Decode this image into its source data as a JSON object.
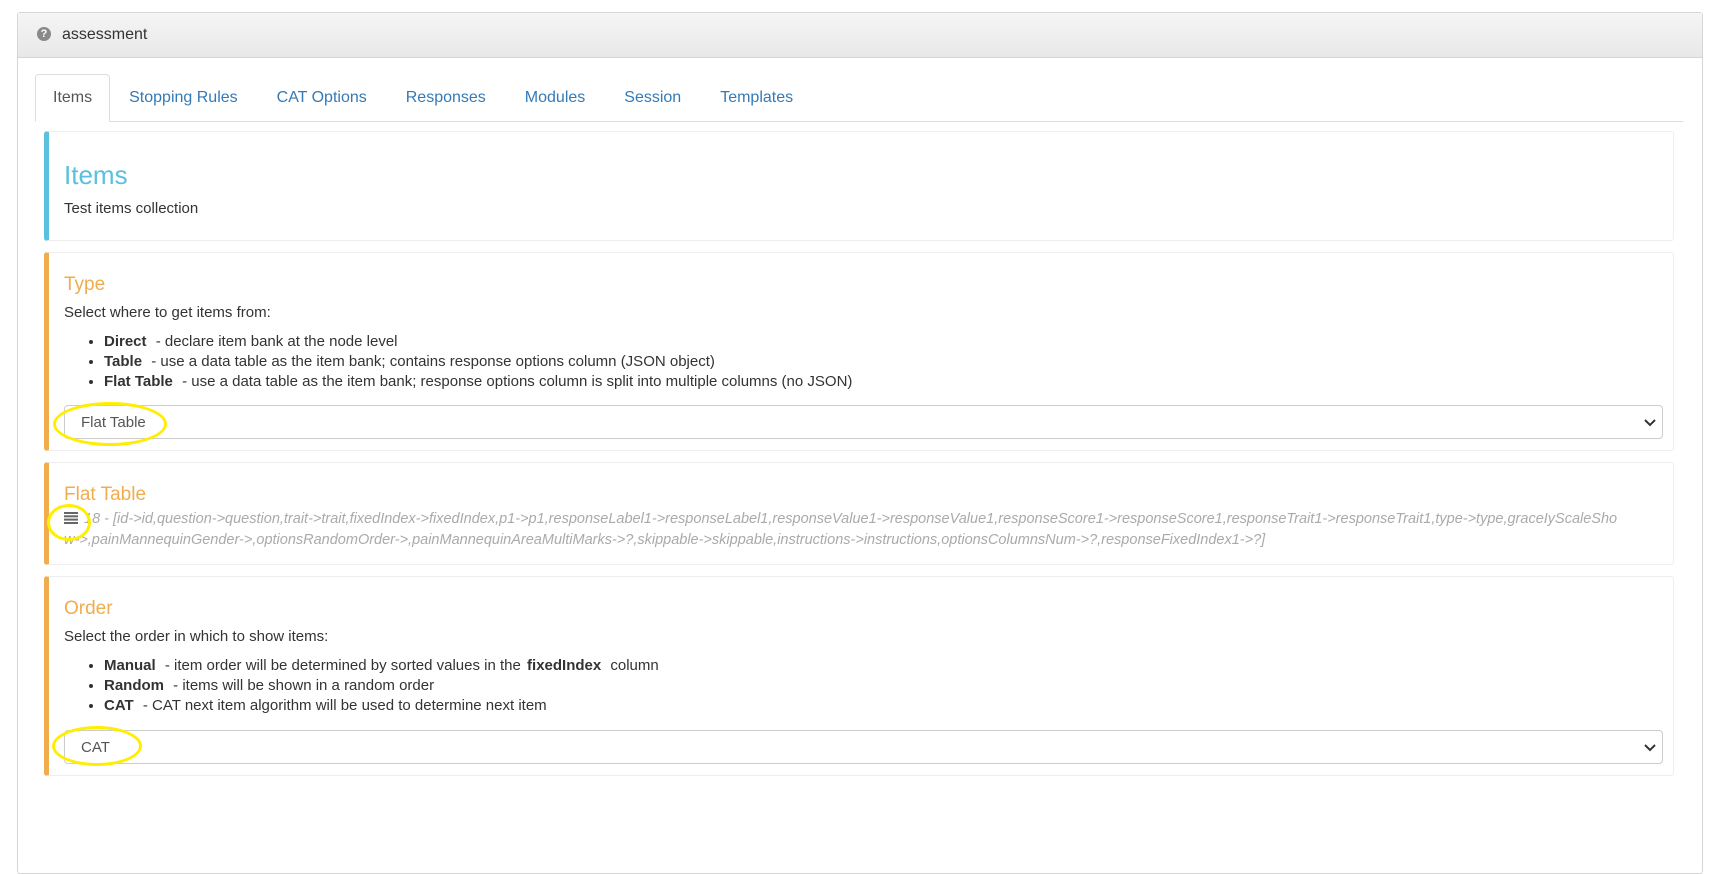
{
  "panel": {
    "title": "assessment"
  },
  "tabs": [
    {
      "label": "Items"
    },
    {
      "label": "Stopping Rules"
    },
    {
      "label": "CAT Options"
    },
    {
      "label": "Responses"
    },
    {
      "label": "Modules"
    },
    {
      "label": "Session"
    },
    {
      "label": "Templates"
    }
  ],
  "items_card": {
    "title": "Items",
    "description": "Test items collection"
  },
  "type_card": {
    "title": "Type",
    "description": "Select where to get items from:",
    "options": [
      {
        "name": "Direct",
        "text": " - declare item bank at the node level"
      },
      {
        "name": "Table",
        "text": " - use a data table as the item bank; contains response options column (JSON object)"
      },
      {
        "name": "Flat Table",
        "text": " - use a data table as the item bank; response options column is split into multiple columns (no JSON)"
      }
    ],
    "selected": "Flat Table"
  },
  "flat_table_card": {
    "title": "Flat Table",
    "mapping": "18 - [id->id,question->question,trait->trait,fixedIndex->fixedIndex,p1->p1,responseLabel1->responseLabel1,responseValue1->responseValue1,responseScore1->responseScore1,responseTrait1->responseTrait1,type->type,graceIyScaleShow->,painMannequinGender->,optionsRandomOrder->,painMannequinAreaMultiMarks->?,skippable->skippable,instructions->instructions,optionsColumnsNum->?,responseFixedIndex1->?]"
  },
  "order_card": {
    "title": "Order",
    "description": "Select the order in which to show items:",
    "options": [
      {
        "name": "Manual",
        "text_before": " - item order will be determined by sorted values in the ",
        "bold": "fixedIndex",
        "text_after": " column"
      },
      {
        "name": "Random",
        "text": " - items will be shown in a random order"
      },
      {
        "name": "CAT",
        "text": " - CAT next item algorithm will be used to determine next item"
      }
    ],
    "selected": "CAT"
  },
  "colors": {
    "accent": "#f0ad4e",
    "info": "#5bc0de",
    "link": "#337ab7",
    "highlight": "#ffee00"
  }
}
